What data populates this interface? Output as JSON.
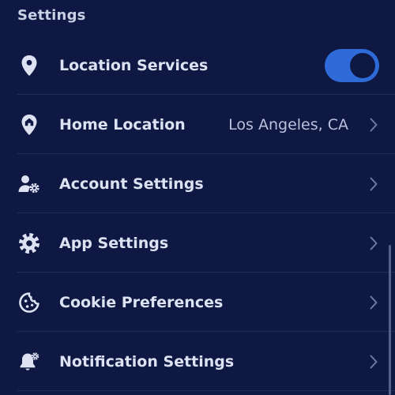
{
  "header": {
    "title": "Settings"
  },
  "items": [
    {
      "label": "Location Services",
      "icon": "location-pin-icon",
      "control": "toggle",
      "toggle_on": true
    },
    {
      "label": "Home Location",
      "icon": "home-pin-icon",
      "value": "Los Angeles, CA",
      "control": "chevron"
    },
    {
      "label": "Account Settings",
      "icon": "user-gear-icon",
      "control": "chevron"
    },
    {
      "label": "App Settings",
      "icon": "gear-icon",
      "control": "chevron"
    },
    {
      "label": "Cookie Preferences",
      "icon": "cookie-icon",
      "control": "chevron"
    },
    {
      "label": "Notification Settings",
      "icon": "bell-gear-icon",
      "control": "chevron"
    }
  ],
  "colors": {
    "background": "#0e1842",
    "toggle_on": "#2e6bd8",
    "divider": "#1f2b5c",
    "text": "#dde2f2"
  }
}
